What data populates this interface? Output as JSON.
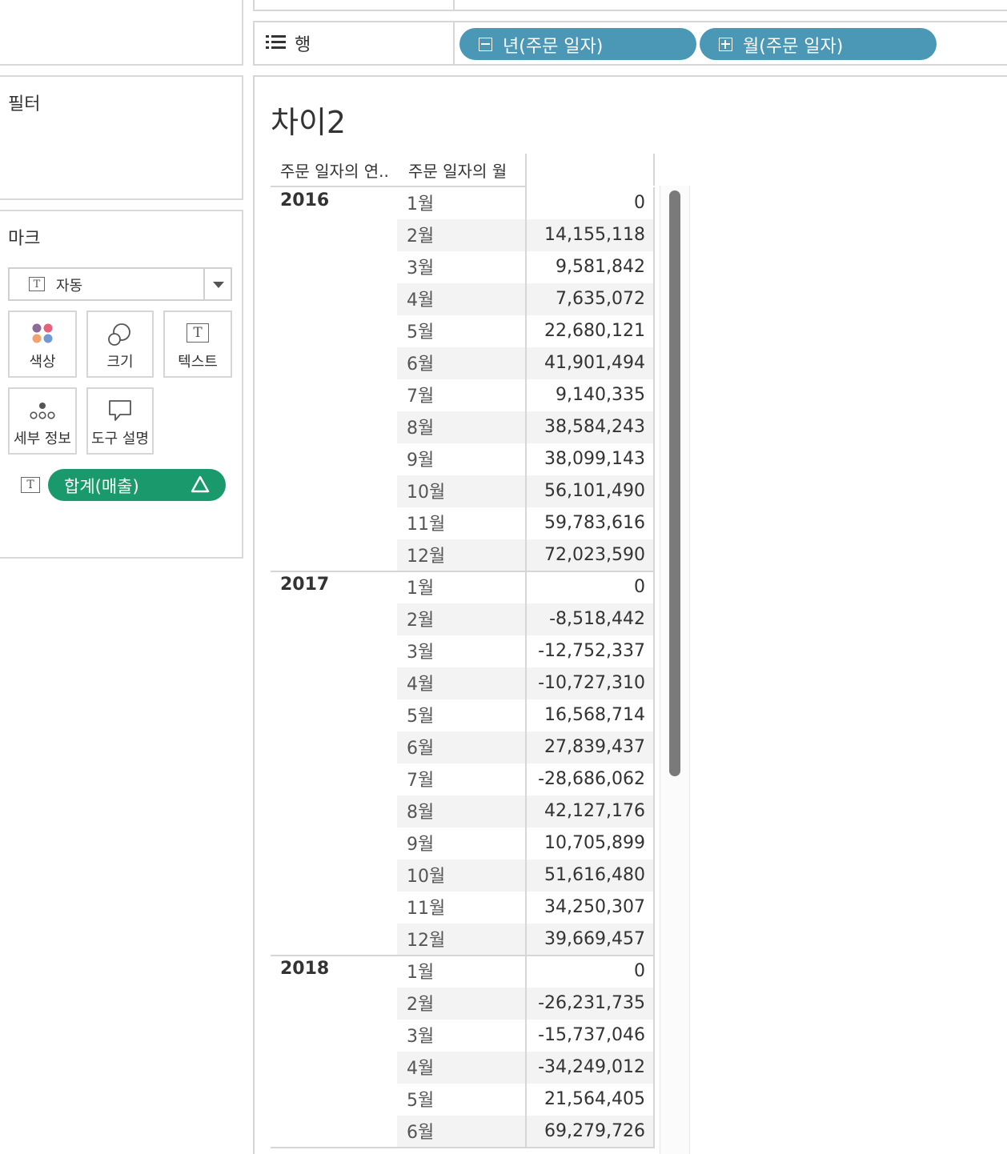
{
  "shelf": {
    "rows_label": "행",
    "pills": [
      {
        "label": "년(주문 일자)",
        "expand": "minus"
      },
      {
        "label": "월(주문 일자)",
        "expand": "plus"
      }
    ]
  },
  "filters": {
    "title": "필터"
  },
  "marks": {
    "title": "마크",
    "mark_type": "자동",
    "cards": [
      {
        "label": "색상",
        "icon": "color-icon"
      },
      {
        "label": "크기",
        "icon": "size-icon"
      },
      {
        "label": "텍스트",
        "icon": "text-icon"
      },
      {
        "label": "세부 정보",
        "icon": "detail-icon"
      },
      {
        "label": "도구 설명",
        "icon": "tooltip-icon"
      }
    ],
    "measure_pill": {
      "label": "합계(매출)",
      "calc_symbol": "Δ",
      "color": "#1a9a6c"
    }
  },
  "view": {
    "title": "차이2",
    "headers": [
      "주문 일자의 연..",
      "주문 일자의 월"
    ],
    "groups": [
      {
        "year": "2016",
        "rows": [
          {
            "month": "1월",
            "value": "0"
          },
          {
            "month": "2월",
            "value": "14,155,118"
          },
          {
            "month": "3월",
            "value": "9,581,842"
          },
          {
            "month": "4월",
            "value": "7,635,072"
          },
          {
            "month": "5월",
            "value": "22,680,121"
          },
          {
            "month": "6월",
            "value": "41,901,494"
          },
          {
            "month": "7월",
            "value": "9,140,335"
          },
          {
            "month": "8월",
            "value": "38,584,243"
          },
          {
            "month": "9월",
            "value": "38,099,143"
          },
          {
            "month": "10월",
            "value": "56,101,490"
          },
          {
            "month": "11월",
            "value": "59,783,616"
          },
          {
            "month": "12월",
            "value": "72,023,590"
          }
        ]
      },
      {
        "year": "2017",
        "rows": [
          {
            "month": "1월",
            "value": "0"
          },
          {
            "month": "2월",
            "value": "-8,518,442"
          },
          {
            "month": "3월",
            "value": "-12,752,337"
          },
          {
            "month": "4월",
            "value": "-10,727,310"
          },
          {
            "month": "5월",
            "value": "16,568,714"
          },
          {
            "month": "6월",
            "value": "27,839,437"
          },
          {
            "month": "7월",
            "value": "-28,686,062"
          },
          {
            "month": "8월",
            "value": "42,127,176"
          },
          {
            "month": "9월",
            "value": "10,705,899"
          },
          {
            "month": "10월",
            "value": "51,616,480"
          },
          {
            "month": "11월",
            "value": "34,250,307"
          },
          {
            "month": "12월",
            "value": "39,669,457"
          }
        ]
      },
      {
        "year": "2018",
        "rows": [
          {
            "month": "1월",
            "value": "0"
          },
          {
            "month": "2월",
            "value": "-26,231,735"
          },
          {
            "month": "3월",
            "value": "-15,737,046"
          },
          {
            "month": "4월",
            "value": "-34,249,012"
          },
          {
            "month": "5월",
            "value": "21,564,405"
          },
          {
            "month": "6월",
            "value": "69,279,726"
          }
        ]
      }
    ]
  }
}
